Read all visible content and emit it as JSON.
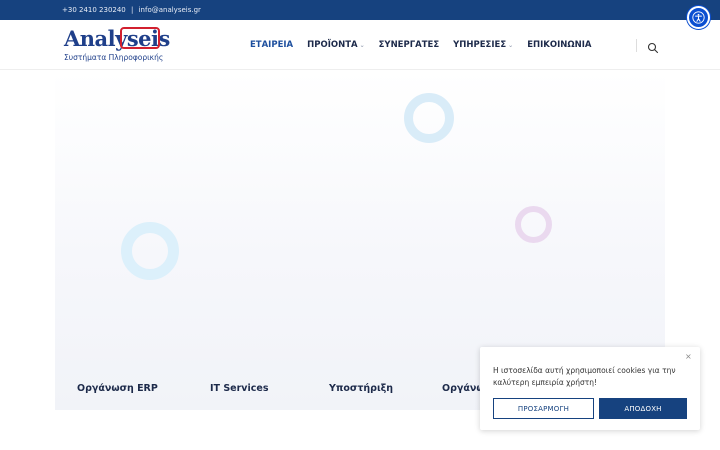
{
  "topbar": {
    "phone": "+30 2410 230240",
    "separator": "|",
    "email": "info@analyseis.gr"
  },
  "accessibility": {
    "icon": "accessibility-icon",
    "color": "#0b4fd1"
  },
  "logo": {
    "word_part1": "Ana",
    "word_part2": "lyseis",
    "subtitle": "Συστήματα Πληροφορικής",
    "brand_color": "#1f3f8a",
    "accent_color": "#d2202f"
  },
  "nav": {
    "items": [
      {
        "label": "ΕΤΑΙΡΕΙΑ",
        "dropdown": false
      },
      {
        "label": "ΠΡΟΪΟΝΤΑ",
        "dropdown": true
      },
      {
        "label": "ΣΥΝΕΡΓΑΤΕΣ",
        "dropdown": false
      },
      {
        "label": "ΥΠΗΡΕΣΙΕΣ",
        "dropdown": true
      },
      {
        "label": "ΕΠΙΚΟΙΝΩΝΙΑ",
        "dropdown": false
      }
    ],
    "search_icon": "search-icon"
  },
  "features": {
    "items": [
      "Οργάνωση ERP",
      "IT Services",
      "Υποστήριξη",
      "Οργάνω"
    ]
  },
  "cookie": {
    "message": "Η ιστοσελίδα αυτή χρησιμοποιεί cookies για την καλύτερη εμπειρία χρήστη!",
    "customize_label": "ΠΡΟΣΑΡΜΟΓΗ",
    "accept_label": "ΑΠΟΔΟΧΗ",
    "close_label": "×"
  },
  "colors": {
    "primary": "#16427f",
    "text_dark": "#1d2a4a"
  }
}
